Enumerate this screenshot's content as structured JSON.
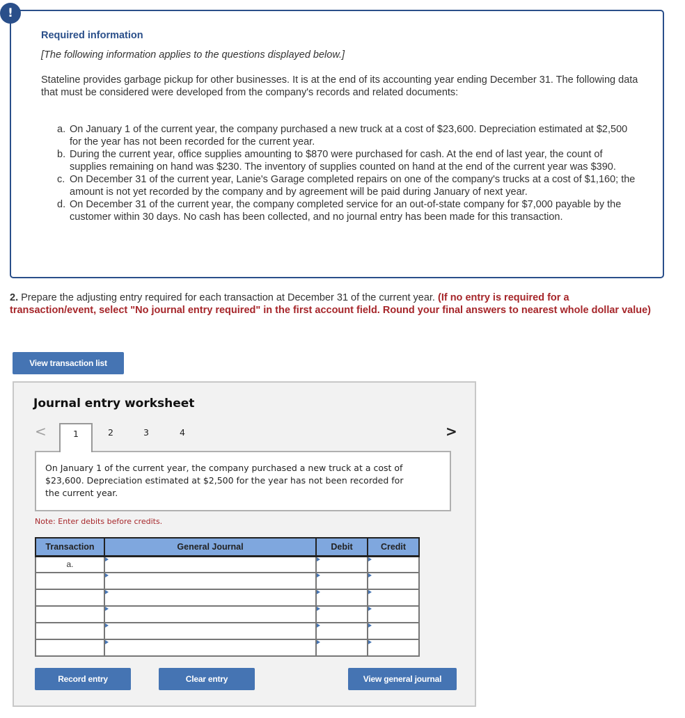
{
  "info": {
    "alert_icon": "!",
    "title": "Required information",
    "subtitle": "[The following information applies to the questions displayed below.]",
    "intro": "Stateline provides garbage pickup for other businesses. It is at the end of its accounting year ending December 31. The following data that must be considered were developed from the company's records and related documents:",
    "items": [
      {
        "label": "a.",
        "text": "On January 1 of the current year, the company purchased a new truck at a cost of $23,600. Depreciation estimated at $2,500 for the year has not been recorded for the current year."
      },
      {
        "label": "b.",
        "text": "During the current year, office supplies amounting to $870 were purchased for cash. At the end of last year, the count of supplies remaining on hand was $230. The inventory of supplies counted on hand at the end of the current year was $390."
      },
      {
        "label": "c.",
        "text": "On December 31 of the current year, Lanie's Garage completed repairs on one of the company's trucks at a cost of $1,160; the amount is not yet recorded by the company and by agreement will be paid during January of next year."
      },
      {
        "label": "d.",
        "text": "On December 31 of the current year, the company completed service for an out-of-state company for $7,000 payable by the customer within 30 days. No cash has been collected, and no journal entry has been made for this transaction."
      }
    ]
  },
  "question": {
    "number": "2.",
    "text": " Prepare the adjusting entry required for each transaction at December 31 of the current year. ",
    "instruction": "(If no entry is required for a transaction/event, select \"No journal entry required\" in the first account field. Round your final answers to nearest whole dollar value)"
  },
  "buttons": {
    "view_transaction_list": "View transaction list",
    "record_entry": "Record entry",
    "clear_entry": "Clear entry",
    "view_general_journal": "View general journal"
  },
  "worksheet": {
    "title": "Journal entry worksheet",
    "prev_icon": "<",
    "next_icon": ">",
    "tabs": [
      "1",
      "2",
      "3",
      "4"
    ],
    "active_tab": "1",
    "description": "On January 1 of the current year, the company purchased a new truck at a cost of $23,600. Depreciation estimated at $2,500 for the year has not been recorded for the current year.",
    "note": "Note: Enter debits before credits.",
    "table": {
      "headers": [
        "Transaction",
        "General Journal",
        "Debit",
        "Credit"
      ],
      "rows": [
        {
          "transaction": "a.",
          "account": "",
          "debit": "",
          "credit": ""
        },
        {
          "transaction": "",
          "account": "",
          "debit": "",
          "credit": ""
        },
        {
          "transaction": "",
          "account": "",
          "debit": "",
          "credit": ""
        },
        {
          "transaction": "",
          "account": "",
          "debit": "",
          "credit": ""
        },
        {
          "transaction": "",
          "account": "",
          "debit": "",
          "credit": ""
        },
        {
          "transaction": "",
          "account": "",
          "debit": "",
          "credit": ""
        }
      ]
    }
  }
}
